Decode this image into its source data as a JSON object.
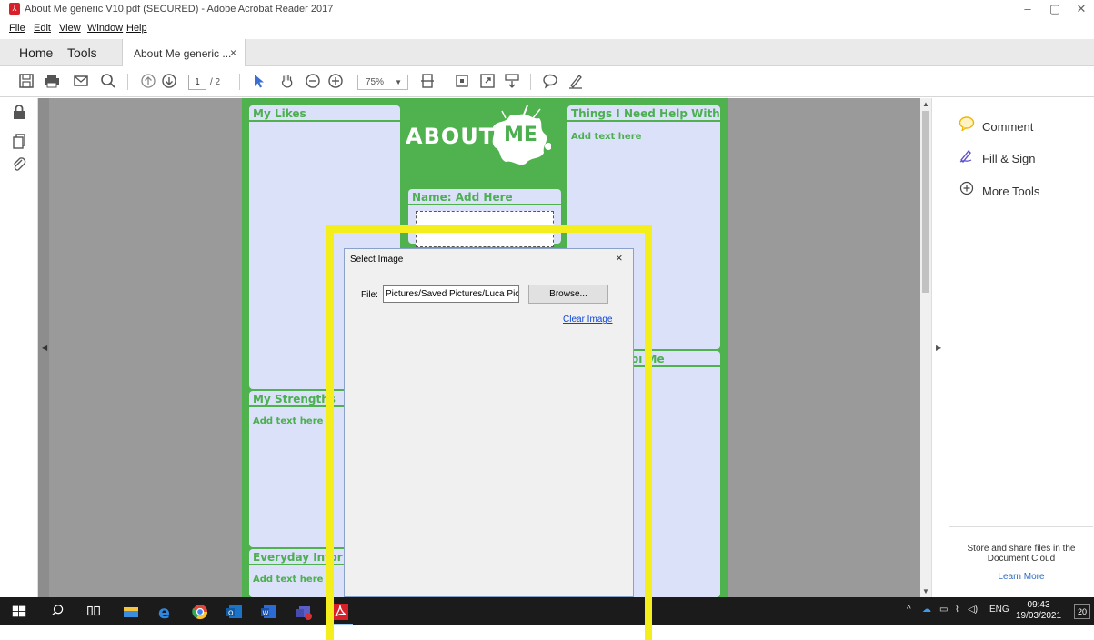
{
  "window": {
    "title": "About Me generic V10.pdf (SECURED) - Adobe Acrobat Reader 2017",
    "minimize": "–",
    "restore": "▢",
    "close": "✕"
  },
  "menu": [
    "File",
    "Edit",
    "View",
    "Window",
    "Help"
  ],
  "tabs": {
    "home": "Home",
    "tools": "Tools",
    "doc": "About Me generic ...",
    "doc_close": "×"
  },
  "toolbar": {
    "page_current": "1",
    "page_total": "/ 2",
    "zoom": "75%"
  },
  "pdf": {
    "header_about": "ABOUT",
    "header_me": "ME",
    "my_likes": "My Likes",
    "need_help": "Things I Need Help With",
    "need_help_text": "Add text here",
    "name": "Name: Add Here",
    "about_me_partial": "oı  Me",
    "my_strengths": "My Strengths",
    "my_strengths_text": "Add text here",
    "everyday": "Everyday Infor  at",
    "everyday_text": "Add text here"
  },
  "dialog": {
    "title": "Select Image",
    "close": "×",
    "file_label": "File:",
    "file_value": "Pictures/Saved Pictures/Luca Pic.jpg",
    "browse": "Browse...",
    "clear": "Clear Image"
  },
  "right_panel": {
    "comment": "Comment",
    "fill_sign": "Fill & Sign",
    "more_tools": "More Tools",
    "cloud_line1": "Store and share files in the",
    "cloud_line2": "Document Cloud",
    "learn_more": "Learn More"
  },
  "taskbar": {
    "lang": "ENG",
    "time": "09:43",
    "date": "19/03/2021",
    "notif_count": "20"
  },
  "colors": {
    "highlight": "#f5ee1d",
    "page_green": "#4fb24f",
    "box_fill": "#dbe1f8"
  }
}
